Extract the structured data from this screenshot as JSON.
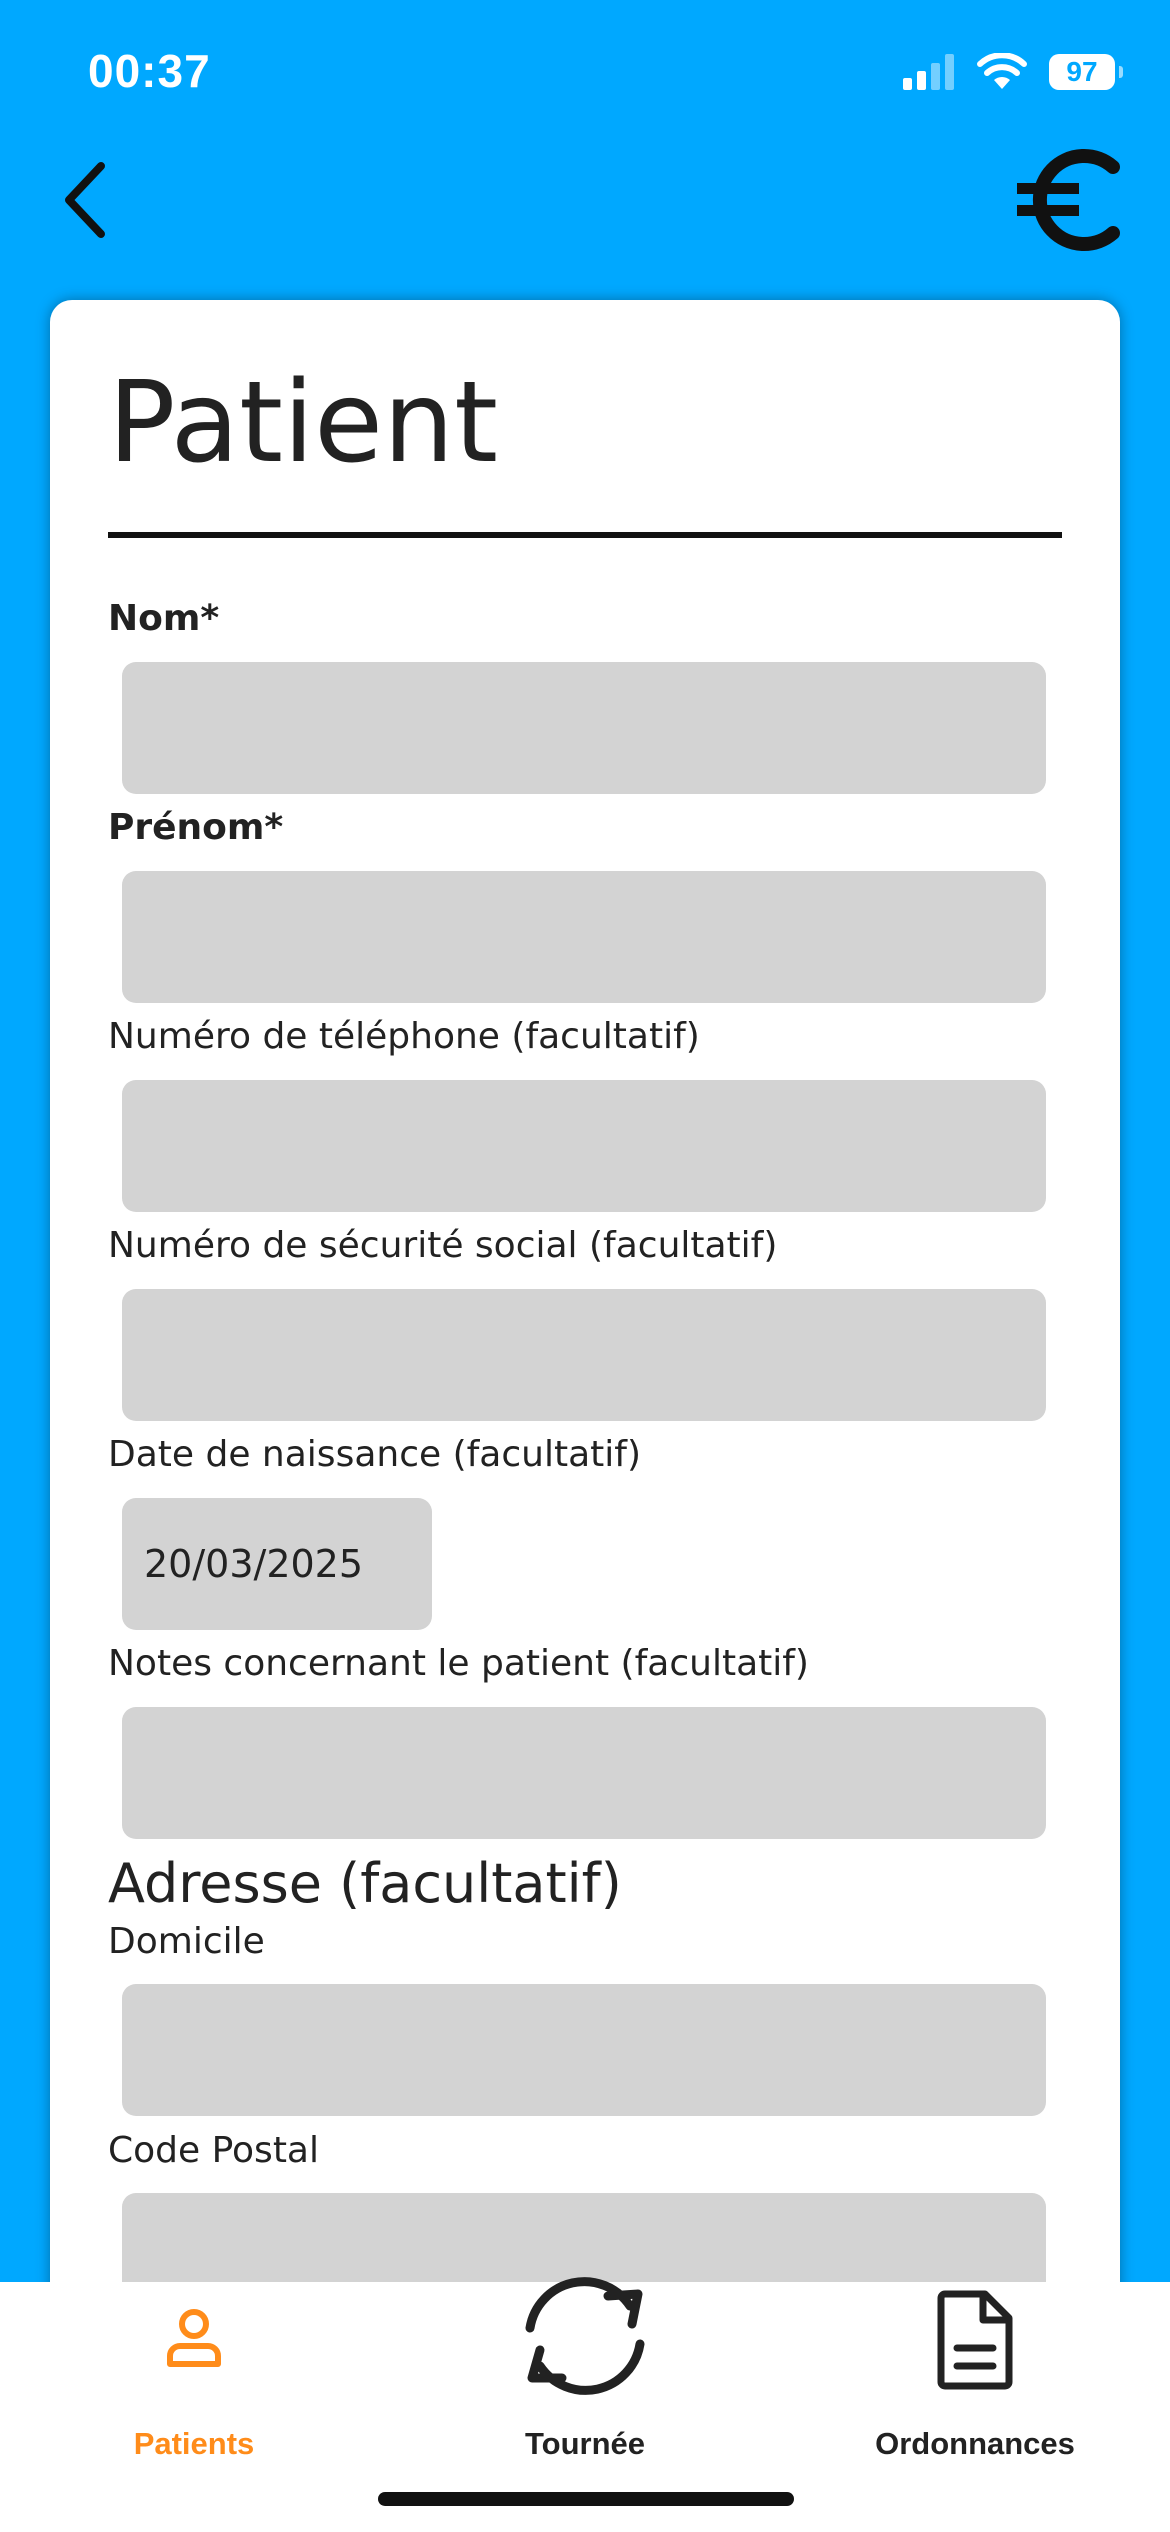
{
  "status_bar": {
    "time": "00:37",
    "battery": "97"
  },
  "nav": {
    "back_icon": "chevron-left-icon",
    "euro_icon": "euro-icon"
  },
  "form": {
    "title": "Patient",
    "fields": {
      "nom": {
        "label": "Nom*",
        "value": ""
      },
      "prenom": {
        "label": "Prénom*",
        "value": ""
      },
      "telephone": {
        "label": "Numéro de téléphone (facultatif)",
        "value": ""
      },
      "securite_sociale": {
        "label": "Numéro de sécurité social (facultatif)",
        "value": ""
      },
      "date_naissance": {
        "label": "Date de naissance (facultatif)",
        "value": "20/03/2025"
      },
      "notes": {
        "label": "Notes concernant le patient (facultatif)",
        "value": ""
      }
    },
    "address": {
      "heading": "Adresse (facultatif)",
      "domicile": {
        "label": "Domicile",
        "value": ""
      },
      "code_postal": {
        "label": "Code Postal",
        "value": ""
      }
    }
  },
  "tabs": [
    {
      "label": "Patients",
      "icon": "person-icon",
      "active": true
    },
    {
      "label": "Tournée",
      "icon": "refresh-icon",
      "active": false
    },
    {
      "label": "Ordonnances",
      "icon": "document-icon",
      "active": false
    }
  ],
  "colors": {
    "background": "#00A8FF",
    "active_tab": "#FF8C1A",
    "field": "#D3D3D3"
  }
}
